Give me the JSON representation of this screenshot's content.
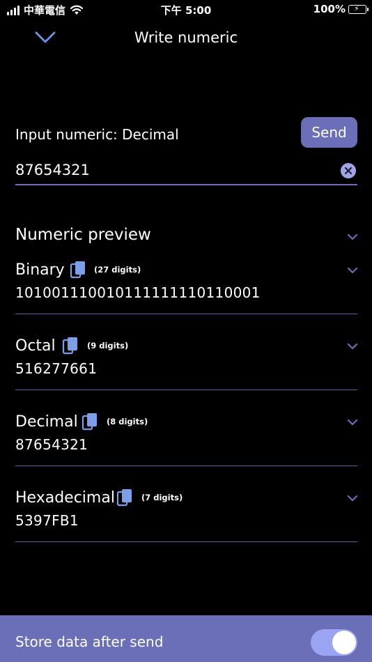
{
  "status_bar": {
    "carrier": "中華電信",
    "time": "下午 5:00",
    "battery": "100%"
  },
  "header": {
    "title": "Write numeric",
    "back_icon": "chevron-down-icon"
  },
  "input": {
    "label": "Input numeric: Decimal",
    "send_label": "Send",
    "value": "87654321",
    "clear_icon": "clear-circle-icon"
  },
  "preview": {
    "title": "Numeric preview",
    "rows": [
      {
        "name": "Binary",
        "digits": "(27 digits)",
        "value": "101001110010111111110110001"
      },
      {
        "name": "Octal",
        "digits": "(9 digits)",
        "value": "516277661"
      },
      {
        "name": "Decimal",
        "digits": "(8 digits)",
        "value": "87654321"
      },
      {
        "name": "Hexadecimal",
        "digits": "(7 digits)",
        "value": "5397FB1"
      }
    ]
  },
  "bottom": {
    "label": "Store data after send",
    "toggle_on": true
  },
  "colors": {
    "accent": "#6b6fb7",
    "divider": "#5d60a8",
    "icon": "#7b9fe8"
  }
}
